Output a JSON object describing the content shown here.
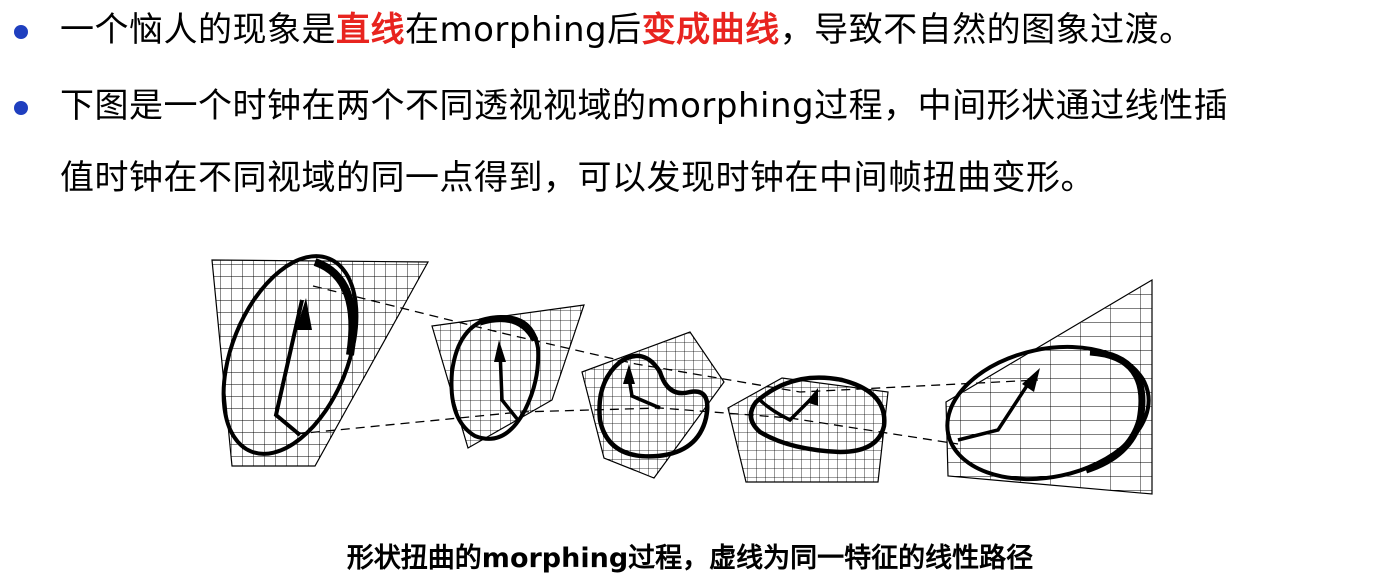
{
  "bullets": [
    {
      "lines": [
        {
          "segments": [
            {
              "text": "一个恼人的现象是",
              "highlight": false
            },
            {
              "text": "直线",
              "highlight": true
            },
            {
              "text": "在morphing后",
              "highlight": false
            },
            {
              "text": "变成曲线",
              "highlight": true
            },
            {
              "text": "，导致不自然的图象过渡。",
              "highlight": false
            }
          ]
        }
      ]
    },
    {
      "lines": [
        {
          "segments": [
            {
              "text": "下图是一个时钟在两个不同透视视域的morphing过程，中间形状通过线性插",
              "highlight": false
            }
          ]
        },
        {
          "segments": [
            {
              "text": "值时钟在不同视域的同一点得到，可以发现时钟在中间帧扭曲变形。",
              "highlight": false
            }
          ]
        }
      ]
    }
  ],
  "figure": {
    "caption": "形状扭曲的morphing过程，虚线为同一特征的线性路径",
    "frame_count": 5
  },
  "colors": {
    "bullet": "#1f3fbf",
    "highlight": "#e8241f",
    "text": "#000000"
  }
}
